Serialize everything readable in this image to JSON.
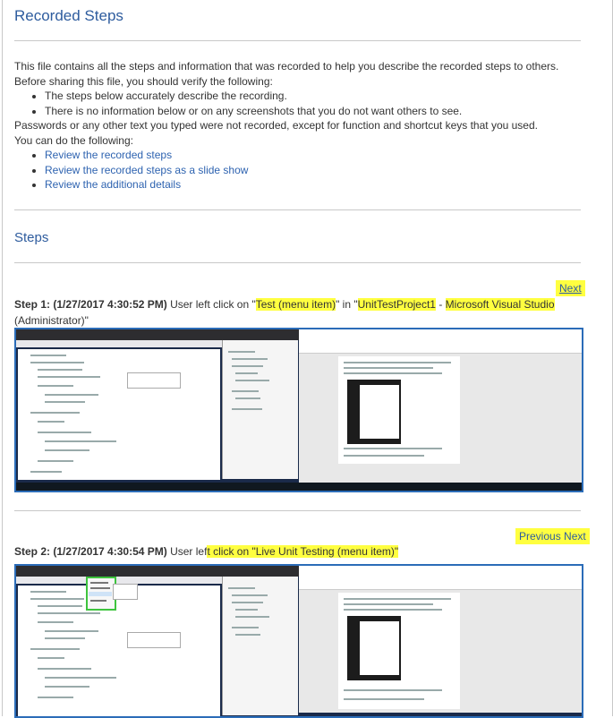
{
  "header": {
    "title": "Recorded Steps"
  },
  "intro": {
    "line1": "This file contains all the steps and information that was recorded to help you describe the recorded steps to others.",
    "line2": "Before sharing this file, you should verify the following:",
    "bullets": [
      "The steps below accurately describe the recording.",
      "There is no information below or on any screenshots that you do not want others to see."
    ],
    "line3": "Passwords or any other text you typed were not recorded, except for function and shortcut keys that you used.",
    "line4": "You can do the following:",
    "links": [
      "Review the recorded steps",
      "Review the recorded steps as a slide show",
      "Review the additional details"
    ]
  },
  "steps_heading": "Steps",
  "step1": {
    "nav_next": "Next",
    "label": "Step 1: (1/27/2017 4:30:52 PM)",
    "text_a": "User left click on \"",
    "target": "Test (menu item)",
    "text_b": "\" in \"",
    "window_a": "UnitTestProject1",
    "text_c": " - ",
    "window_b": "Microsoft Visual Studio",
    "text_d": "(Administrator)\""
  },
  "step2": {
    "nav_prev": "Previous",
    "nav_next": "Next",
    "label": "Step 2: (1/27/2017 4:30:54 PM)",
    "text_a": "User lef",
    "text_hl": "t click on \"Live Unit Testing (menu item)\""
  },
  "colors": {
    "accent": "#2e5c9e",
    "highlight": "#ffff40",
    "shot_border": "#2b6cb8"
  }
}
